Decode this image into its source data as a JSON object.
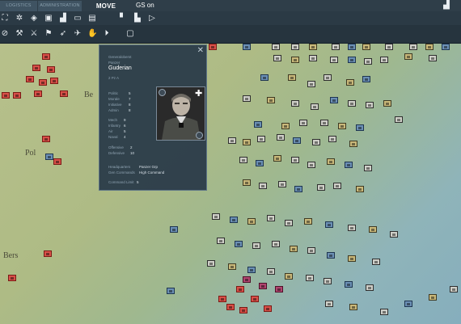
{
  "tabs": [
    {
      "label": "LOGISTICS"
    },
    {
      "label": "ADMINISTRATION"
    },
    {
      "label": "MOVE"
    }
  ],
  "gs_label": "GS on",
  "map_labels": [
    "Pol",
    "Be",
    "Bers"
  ],
  "popup": {
    "rank_label": "Generaloberst",
    "role_label": "Panzer",
    "commander_name": "Guderian",
    "unit_id": "2 Pz A",
    "skills": [
      {
        "label": "Politic",
        "value": "5"
      },
      {
        "label": "Morale",
        "value": "7"
      },
      {
        "label": "Initiative",
        "value": "8"
      },
      {
        "label": "Admin",
        "value": "8"
      },
      {
        "label": "Mech",
        "value": "9"
      },
      {
        "label": "Infantry",
        "value": "6"
      },
      {
        "label": "Air",
        "value": "5"
      },
      {
        "label": "Naval",
        "value": "4"
      }
    ],
    "offense_defense": [
      {
        "label": "Offensive",
        "value": "2"
      },
      {
        "label": "Defensive",
        "value": "10"
      }
    ],
    "hq_assignments": [
      {
        "label": "Headquarters",
        "value": "Panzer Grp"
      },
      {
        "label": "Gen Commands",
        "value": "High Command"
      }
    ],
    "command_limit": {
      "label": "Command Limit",
      "value": "5"
    }
  }
}
